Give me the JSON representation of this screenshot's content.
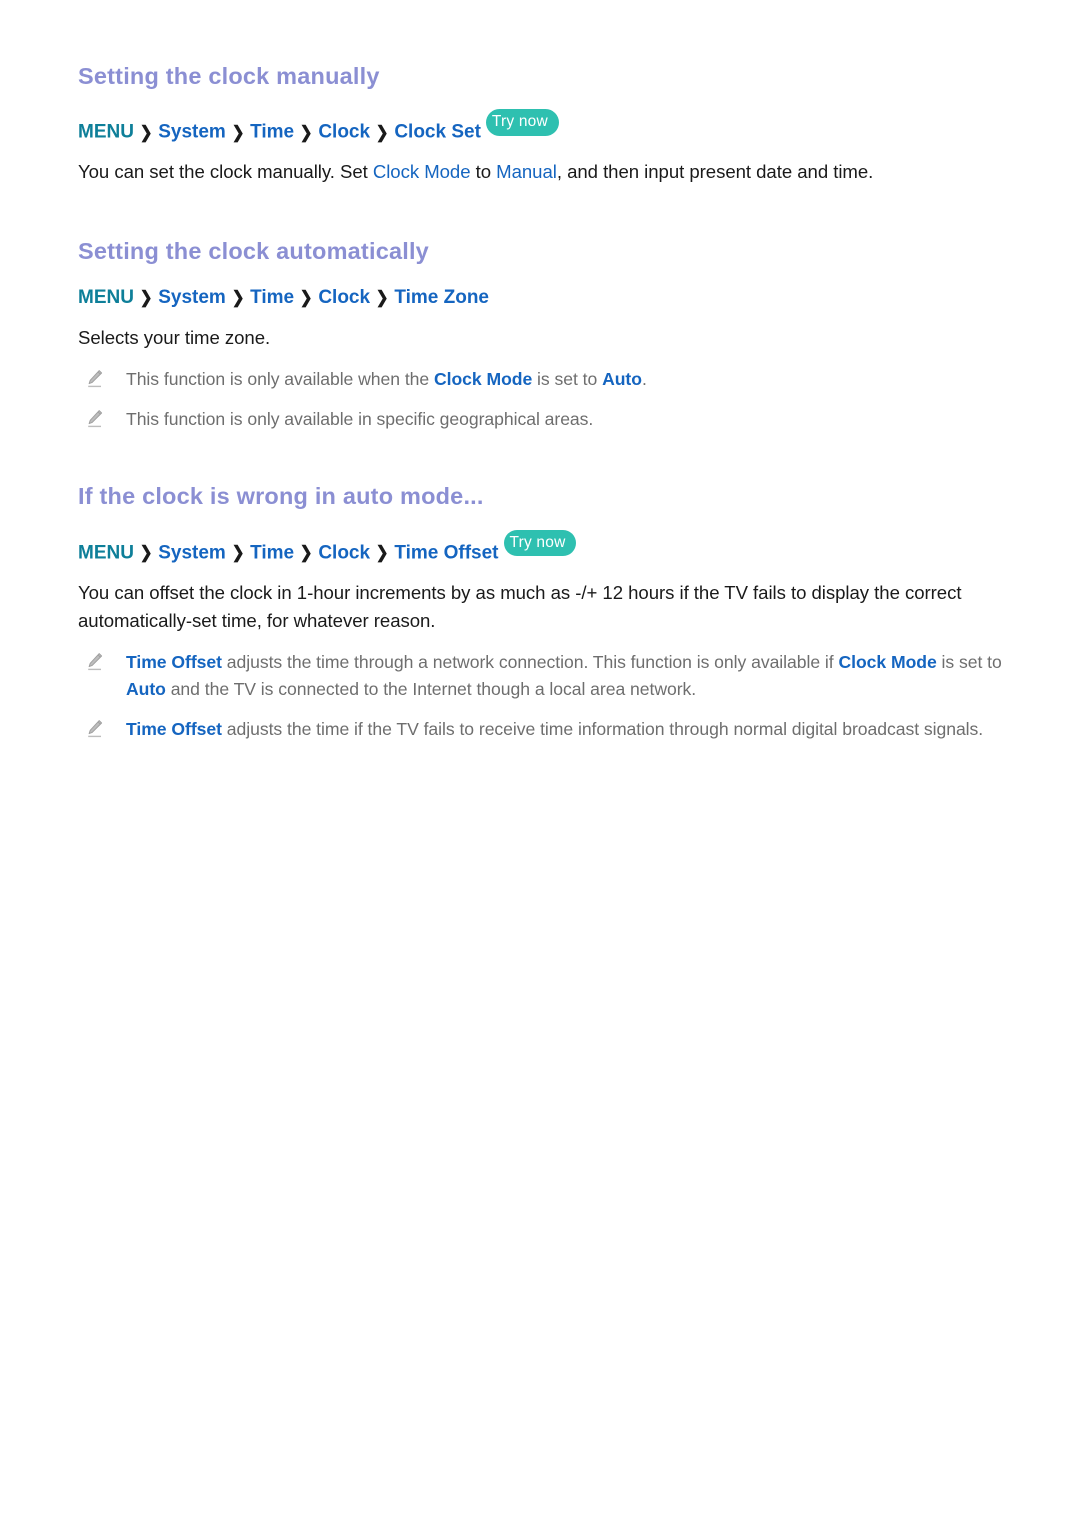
{
  "page": {
    "background_color": "#ffffff",
    "heading_color": "#8b8fd3",
    "link_color": "#1565c0",
    "menu_color": "#0e7f99",
    "badge_color": "#2ec0b0",
    "note_text_color": "#6e6e6e",
    "body_text_color": "#1a1a1a"
  },
  "sections": [
    {
      "heading": "Setting the clock manually",
      "breadcrumb": {
        "root": "MENU",
        "separator": "❯",
        "items": [
          "System",
          "Time",
          "Clock",
          "Clock Set"
        ],
        "badge": "Try now"
      },
      "paragraph": {
        "p1_a": "You can set the clock manually. Set ",
        "p1_kw1": "Clock Mode",
        "p1_b": " to ",
        "p1_kw2": "Manual",
        "p1_c": ", and then input present date and time."
      }
    },
    {
      "heading": "Setting the clock automatically",
      "breadcrumb": {
        "root": "MENU",
        "separator": "❯",
        "items": [
          "System",
          "Time",
          "Clock",
          "Time Zone"
        ],
        "badge": ""
      },
      "paragraph": {
        "p1_a": "Selects your time zone."
      },
      "notes": [
        {
          "icon": "pencil-note-icon",
          "a": "This function is only available when the ",
          "kw1": "Clock Mode",
          "b": " is set to ",
          "kw2": "Auto",
          "c": "."
        },
        {
          "icon": "pencil-note-icon",
          "a": "This function is only available in specific geographical areas.",
          "kw1": "",
          "b": "",
          "kw2": "",
          "c": ""
        }
      ]
    },
    {
      "heading": "If the clock is wrong in auto mode...",
      "breadcrumb": {
        "root": "MENU",
        "separator": "❯",
        "items": [
          "System",
          "Time",
          "Clock",
          "Time Offset"
        ],
        "badge": "Try now"
      },
      "paragraph": {
        "p1_a": "You can offset the clock in 1-hour increments by as much as -/+ 12 hours if the TV fails to display the correct automatically-set time, for whatever reason."
      },
      "notes": [
        {
          "icon": "pencil-note-icon",
          "kw_lead": "Time Offset",
          "a": " adjusts the time through a network connection. This function is only available if ",
          "kw1": "Clock Mode",
          "b": " is set to ",
          "kw2": "Auto",
          "c": " and the TV is connected to the Internet though a local area network."
        },
        {
          "icon": "pencil-note-icon",
          "kw_lead": "Time Offset",
          "a": " adjusts the time if the TV fails to receive time information through normal digital broadcast signals.",
          "kw1": "",
          "b": "",
          "kw2": "",
          "c": ""
        }
      ]
    }
  ]
}
